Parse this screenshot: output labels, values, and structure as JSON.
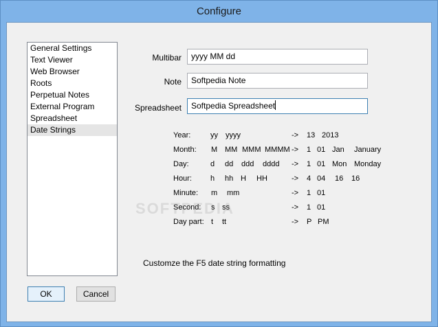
{
  "window": {
    "title": "Configure"
  },
  "sidebar": {
    "items": [
      {
        "label": "General Settings"
      },
      {
        "label": "Text Viewer"
      },
      {
        "label": "Web Browser"
      },
      {
        "label": "Roots"
      },
      {
        "label": "Perpetual Notes"
      },
      {
        "label": "External Program"
      },
      {
        "label": "Spreadsheet"
      },
      {
        "label": "Date Strings",
        "selected": true
      }
    ]
  },
  "form": {
    "multibar": {
      "label": "Multibar",
      "value": "yyyy MM dd"
    },
    "note": {
      "label": "Note",
      "value": "Softpedia Note"
    },
    "spreadsheet": {
      "label": "Spreadsheet",
      "value": "Softpedia Spreadsheet"
    }
  },
  "date_strings": {
    "rows": [
      {
        "name": "Year:",
        "codes": [
          "yy",
          "yyyy"
        ],
        "arrow": "->",
        "examples": [
          "13",
          "2013"
        ]
      },
      {
        "name": "Month:",
        "codes": [
          "M",
          "MM",
          "MMM",
          "MMMM"
        ],
        "arrow": "->",
        "examples": [
          "1",
          "01",
          "Jan",
          "January"
        ]
      },
      {
        "name": "Day:",
        "codes": [
          "d",
          "dd",
          "ddd",
          "dddd"
        ],
        "arrow": "->",
        "examples": [
          "1",
          "01",
          "Mon",
          "Monday"
        ]
      },
      {
        "name": "Hour:",
        "codes": [
          "h",
          "hh",
          "H",
          "HH"
        ],
        "arrow": "->",
        "examples": [
          "4",
          "04",
          "16",
          "16"
        ]
      },
      {
        "name": "Minute:",
        "codes": [
          "m",
          "mm"
        ],
        "arrow": "->",
        "examples": [
          "1",
          "01"
        ]
      },
      {
        "name": "Second:",
        "codes": [
          "s",
          "ss"
        ],
        "arrow": "->",
        "examples": [
          "1",
          "01"
        ]
      },
      {
        "name": "Day part:",
        "codes": [
          "t",
          "tt"
        ],
        "arrow": "->",
        "examples": [
          "P",
          "PM"
        ]
      }
    ]
  },
  "hint": "Customze the F5 date string formatting",
  "buttons": {
    "ok": "OK",
    "cancel": "Cancel"
  },
  "watermark": "SOFTPEDIA"
}
